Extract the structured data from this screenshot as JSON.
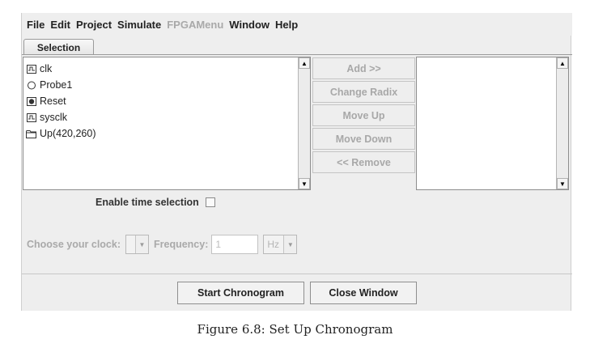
{
  "menubar": {
    "items": [
      {
        "label": "File",
        "enabled": true
      },
      {
        "label": "Edit",
        "enabled": true
      },
      {
        "label": "Project",
        "enabled": true
      },
      {
        "label": "Simulate",
        "enabled": true
      },
      {
        "label": "FPGAMenu",
        "enabled": false
      },
      {
        "label": "Window",
        "enabled": true
      },
      {
        "label": "Help",
        "enabled": true
      }
    ]
  },
  "tab": {
    "label": "Selection"
  },
  "signals": [
    {
      "label": "clk",
      "icon": "clock-signal-icon"
    },
    {
      "label": "Probe1",
      "icon": "probe-circle-icon"
    },
    {
      "label": "Reset",
      "icon": "pin-square-icon"
    },
    {
      "label": "sysclk",
      "icon": "clock-signal-icon"
    },
    {
      "label": "Up(420,260)",
      "icon": "folder-icon"
    }
  ],
  "selected_signals": [],
  "actions": {
    "add": "Add >>",
    "change_radix": "Change Radix",
    "move_up": "Move Up",
    "move_down": "Move Down",
    "remove": "<< Remove"
  },
  "time_selection": {
    "label": "Enable time selection",
    "checked": false
  },
  "clock": {
    "label": "Choose your clock:",
    "selected": "",
    "frequency_label": "Frequency:",
    "frequency_value": "1",
    "unit": "Hz"
  },
  "buttons": {
    "start": "Start Chronogram",
    "close": "Close Window"
  },
  "caption": "Figure 6.8: Set Up Chronogram",
  "colors": {
    "background": "#eeeeee",
    "disabled_text": "#a9a9a9",
    "list_background": "#ffffff"
  }
}
